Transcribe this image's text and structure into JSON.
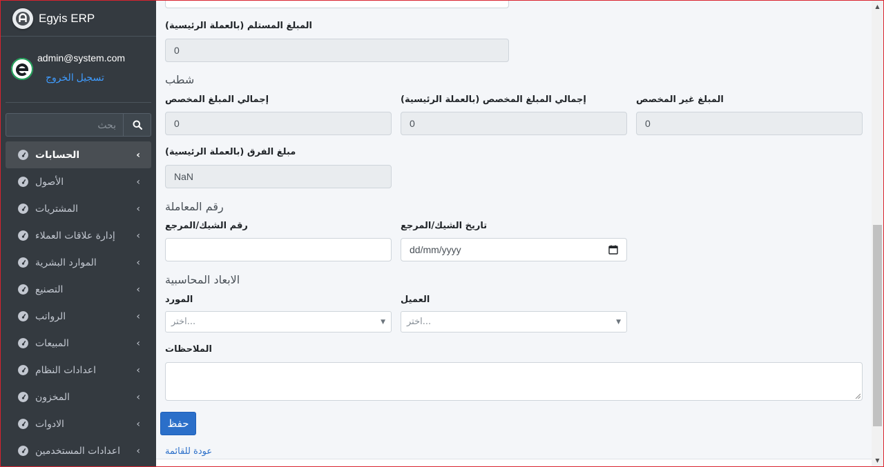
{
  "sidebar": {
    "brand": "Egyis ERP",
    "user_email": "admin@system.com",
    "logout_label": "تسجيل الخروج",
    "search_placeholder": "بحث",
    "items": [
      {
        "label": "الحسابات",
        "active": true
      },
      {
        "label": "الأصول"
      },
      {
        "label": "المشتريات"
      },
      {
        "label": "إدارة علاقات العملاء"
      },
      {
        "label": "الموارد البشرية"
      },
      {
        "label": "التصنيع"
      },
      {
        "label": "الرواتب"
      },
      {
        "label": "المبيعات"
      },
      {
        "label": "اعدادات النظام"
      },
      {
        "label": "المخزون"
      },
      {
        "label": "الادوات"
      },
      {
        "label": "اعدادات المستخدمين"
      }
    ]
  },
  "form": {
    "received_amount_label": "المبلغ المستلم (بالعملة الرئيسية)",
    "received_amount_value": "0",
    "writeoff_section": "شطب",
    "total_allocated_label": "إجمالي المبلغ المخصص",
    "total_allocated_value": "0",
    "total_allocated_base_label": "إجمالي المبلغ المخصص (بالعملة الرئيسية)",
    "total_allocated_base_value": "0",
    "unallocated_label": "المبلغ غير المخصص",
    "unallocated_value": "0",
    "difference_label": "مبلغ الفرق (بالعملة الرئيسية)",
    "difference_value": "NaN",
    "transaction_section": "رقم المعاملة",
    "cheque_ref_label": "رقم الشيك/المرجع",
    "cheque_ref_value": "",
    "cheque_date_label": "تاريخ الشيك/المرجع",
    "cheque_date_placeholder": "dd/mm/yyyy",
    "dimensions_section": "الابعاد المحاسبية",
    "supplier_label": "المورد",
    "supplier_placeholder": "اختر...",
    "customer_label": "العميل",
    "customer_placeholder": "اختر...",
    "notes_label": "الملاحظات",
    "save_label": "حفظ",
    "back_label": "عودة للقائمة"
  }
}
